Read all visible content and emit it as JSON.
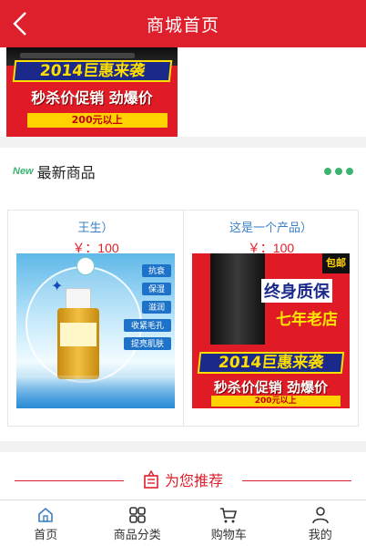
{
  "header": {
    "title": "商城首页"
  },
  "banner": {
    "year_text": "2014巨惠来袭",
    "sale_text": "秒杀价促销 劲爆价",
    "tag_text": "200元以上"
  },
  "new_section": {
    "badge": "New",
    "title": "最新商品"
  },
  "products": [
    {
      "name": "王生）",
      "price": "￥：100"
    },
    {
      "name": "这是一个产品）",
      "price": "￥：100",
      "image_texts": {
        "ribbon": "包邮",
        "headline": "终身质保",
        "sub": "七年老店",
        "year": "2014巨惠来袭",
        "sale": "秒杀价促销 劲爆价",
        "tag": "200元以上"
      }
    }
  ],
  "serum_tags": [
    "抗衰",
    "保湿",
    "滋润",
    "收紧毛孔",
    "提亮肌肤"
  ],
  "recommend": {
    "title": "为您推荐"
  },
  "tabs": [
    {
      "label": "首页",
      "icon": "home-icon",
      "active": true
    },
    {
      "label": "商品分类",
      "icon": "grid-icon",
      "active": false
    },
    {
      "label": "购物车",
      "icon": "cart-icon",
      "active": false
    },
    {
      "label": "我的",
      "icon": "user-icon",
      "active": false
    }
  ],
  "colors": {
    "brand_red": "#de1f2c",
    "accent_green": "#3cb371",
    "link_blue": "#3a7fc4"
  }
}
